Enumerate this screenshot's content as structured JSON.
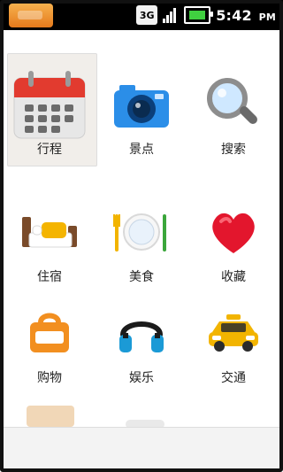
{
  "status_bar": {
    "network": "3G",
    "time": "5:42",
    "time_suffix": "PM",
    "icons": [
      "app-icon",
      "network-3g-icon",
      "signal-icon",
      "battery-icon"
    ]
  },
  "menu_items": [
    {
      "label": "行程",
      "icon": "calendar-icon"
    },
    {
      "label": "景点",
      "icon": "camera-icon"
    },
    {
      "label": "搜索",
      "icon": "magnifier-icon"
    },
    {
      "label": "住宿",
      "icon": "bed-icon"
    },
    {
      "label": "美食",
      "icon": "plate-icon"
    },
    {
      "label": "收藏",
      "icon": "heart-icon"
    },
    {
      "label": "购物",
      "icon": "bag-icon"
    },
    {
      "label": "娱乐",
      "icon": "headphones-icon"
    },
    {
      "label": "交通",
      "icon": "taxi-icon"
    }
  ],
  "colors": {
    "accent_orange": "#f28f20",
    "heart_red": "#e3162d",
    "camera_blue": "#2b8ee8"
  }
}
